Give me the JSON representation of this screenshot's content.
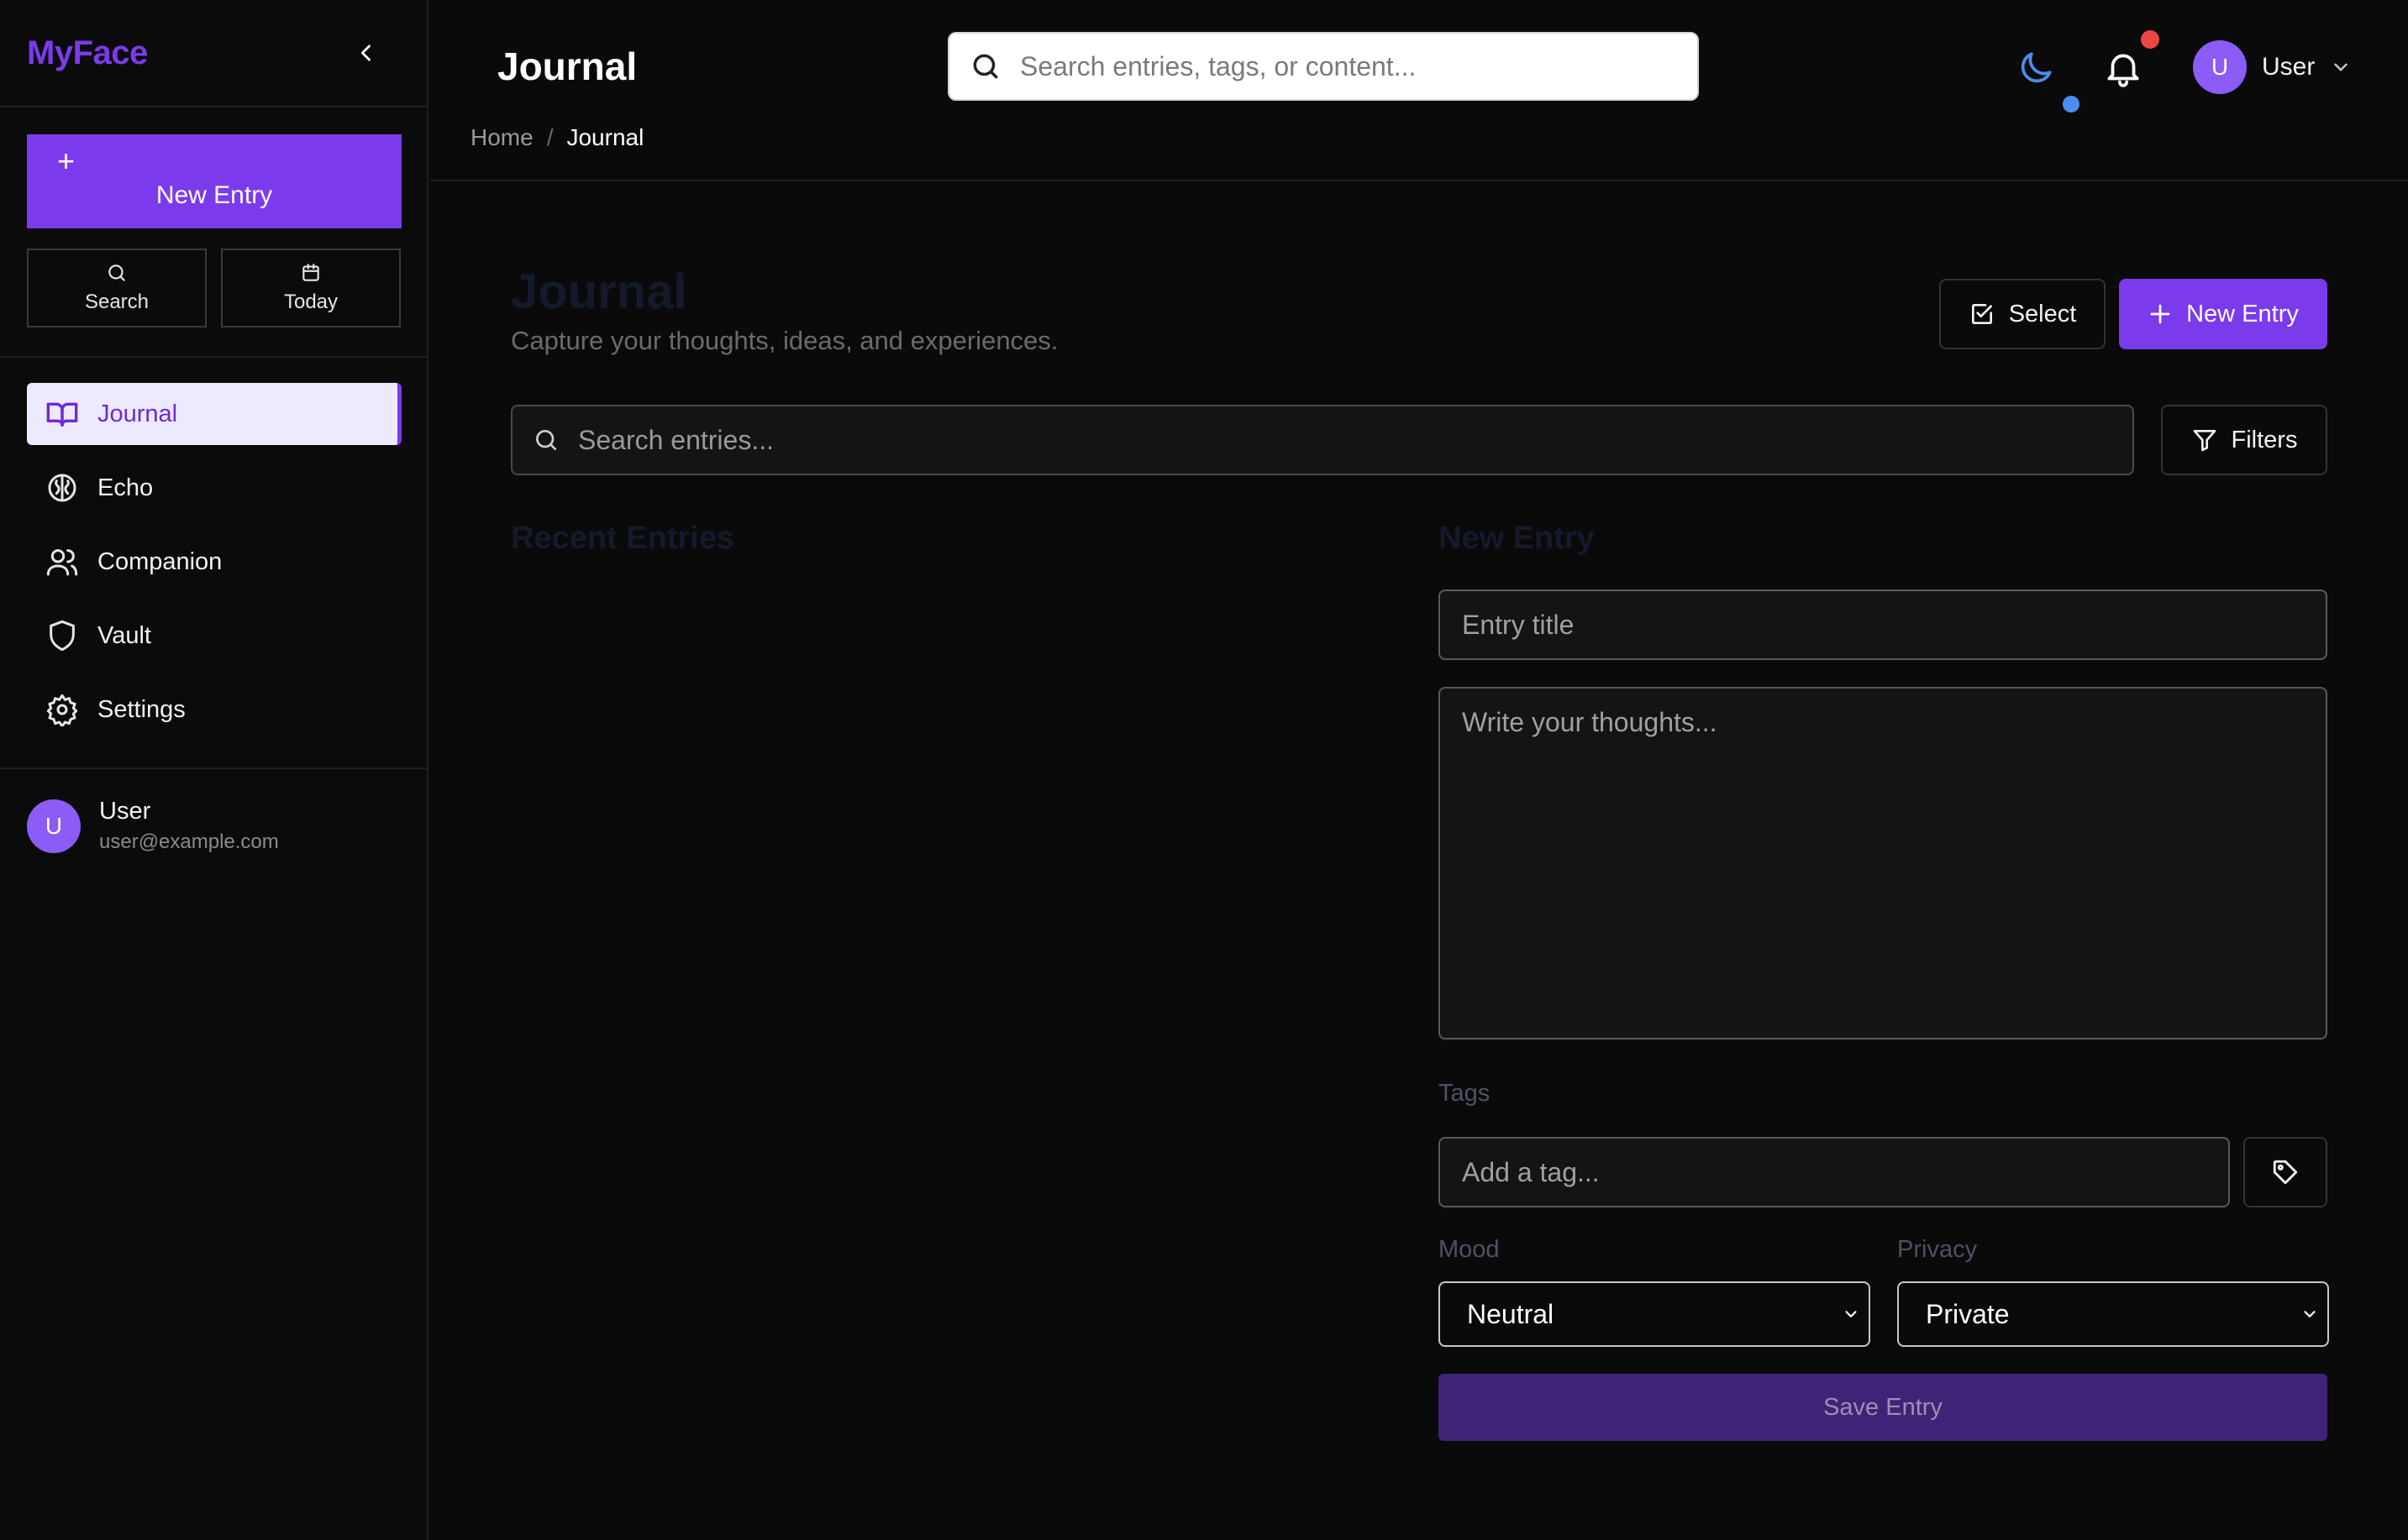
{
  "sidebar": {
    "brand": "MyFace",
    "new_entry_label": "New Entry",
    "quick": {
      "search_label": "Search",
      "today_label": "Today"
    },
    "nav": [
      {
        "label": "Journal",
        "icon": "book-open-icon",
        "active": true
      },
      {
        "label": "Echo",
        "icon": "brain-icon",
        "active": false
      },
      {
        "label": "Companion",
        "icon": "users-icon",
        "active": false
      },
      {
        "label": "Vault",
        "icon": "shield-icon",
        "active": false
      },
      {
        "label": "Settings",
        "icon": "gear-icon",
        "active": false
      }
    ],
    "user": {
      "initial": "U",
      "name": "User",
      "email": "user@example.com"
    }
  },
  "header": {
    "title": "Journal",
    "search_placeholder": "Search entries, tags, or content...",
    "user": {
      "initial": "U",
      "name": "User"
    },
    "breadcrumb": {
      "home": "Home",
      "separator": "/",
      "current": "Journal"
    }
  },
  "main": {
    "title": "Journal",
    "subtitle": "Capture your thoughts, ideas, and experiences.",
    "select_label": "Select",
    "new_entry_label": "New Entry",
    "search_placeholder": "Search entries...",
    "filters_label": "Filters",
    "recent_heading": "Recent Entries",
    "form": {
      "heading": "New Entry",
      "title_placeholder": "Entry title",
      "body_placeholder": "Write your thoughts...",
      "tags_label": "Tags",
      "tag_placeholder": "Add a tag...",
      "mood_label": "Mood",
      "mood_value": "Neutral",
      "privacy_label": "Privacy",
      "privacy_value": "Private",
      "save_label": "Save Entry"
    }
  },
  "colors": {
    "accent": "#7c3aed",
    "background": "#0a0a0a",
    "notification_dot": "#ef4444",
    "theme_dot": "#4a8ef0"
  }
}
